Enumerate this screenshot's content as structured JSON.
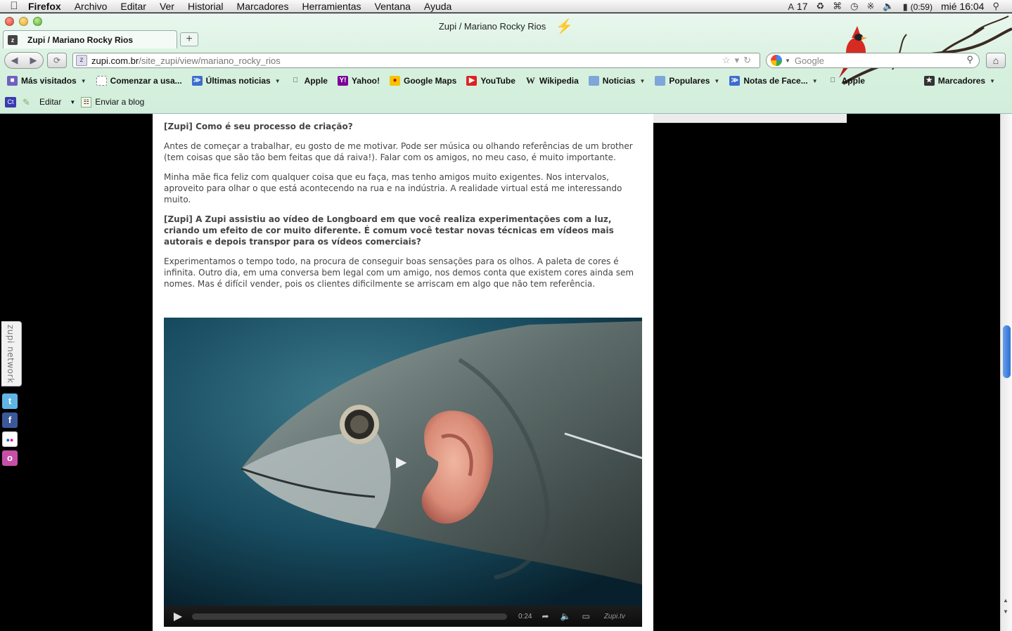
{
  "menubar": {
    "app_name": "Firefox",
    "items": [
      "Archivo",
      "Editar",
      "Ver",
      "Historial",
      "Marcadores",
      "Herramientas",
      "Ventana",
      "Ayuda"
    ],
    "status": {
      "adobe_count": "17",
      "battery": "(0:59)",
      "clock": "mié 16:04"
    }
  },
  "window": {
    "title": "Zupi / Mariano Rocky Rios"
  },
  "tab": {
    "label": "Zupi / Mariano Rocky Rios",
    "new_tab": "+"
  },
  "navigation": {
    "url_host": "zupi.com.br",
    "url_path": "/site_zupi/view/mariano_rocky_rios",
    "search_placeholder": "Google"
  },
  "bookmarks": {
    "items": [
      {
        "label": "Más visitados",
        "icon": "most-visited-icon",
        "dropdown": true
      },
      {
        "label": "Comenzar a usa...",
        "icon": "page-icon",
        "dropdown": false
      },
      {
        "label": "Últimas noticias",
        "icon": "rss-icon",
        "dropdown": true
      },
      {
        "label": "Apple",
        "icon": "apple-icon",
        "dropdown": false
      },
      {
        "label": "Yahoo!",
        "icon": "yahoo-icon",
        "dropdown": false
      },
      {
        "label": "Google Maps",
        "icon": "google-maps-icon",
        "dropdown": false
      },
      {
        "label": "YouTube",
        "icon": "youtube-icon",
        "dropdown": false
      },
      {
        "label": "Wikipedia",
        "icon": "wikipedia-icon",
        "dropdown": false
      },
      {
        "label": "Noticias",
        "icon": "folder-icon",
        "dropdown": true
      },
      {
        "label": "Populares",
        "icon": "folder-icon",
        "dropdown": true
      },
      {
        "label": "Notas de Face...",
        "icon": "rss-icon",
        "dropdown": true
      },
      {
        "label": "Apple",
        "icon": "apple-icon",
        "dropdown": false
      }
    ],
    "marcadores_label": "Marcadores"
  },
  "extension_bar": {
    "ct_label": "Ct",
    "edit_label": "Editar",
    "blog_label": "Enviar a blog"
  },
  "article": {
    "q1": "[Zupi] Como é seu processo de criação?",
    "a1": "Antes de começar a trabalhar, eu gosto de me motivar. Pode ser música ou olhando referências de um brother (tem coisas que são tão bem feitas que dá raiva!). Falar com os amigos, no meu caso, é muito importante.",
    "a2": "Minha mãe fica feliz com qualquer coisa que eu faça, mas tenho amigos muito exigentes. Nos intervalos, aproveito para olhar o que está acontecendo na rua e na indústria. A realidade virtual está me interessando muito.",
    "q2": "[Zupi] A Zupi assistiu ao vídeo de Longboard em que você realiza experimentações com a luz, criando um efeito de cor muito diferente. É comum você testar novas técnicas em vídeos mais autorais e depois transpor para os vídeos comerciais?",
    "a3": "Experimentamos o tempo todo, na procura de conseguir boas sensações para os olhos.  A paleta de cores é infinita. Outro dia, em uma conversa bem legal com um amigo, nos demos conta que existem cores ainda sem nomes. Mas é difícil vender, pois os clientes dificilmente se arriscam em algo que não tem referência."
  },
  "video": {
    "time": "0:24",
    "brand": "Zupi.tv",
    "progress": 0
  },
  "side_tab": {
    "label": "zupi network"
  },
  "social": [
    {
      "name": "twitter-icon",
      "glyph": "t",
      "color": "#5fb6e6"
    },
    {
      "name": "facebook-icon",
      "glyph": "f",
      "color": "#3b5998"
    },
    {
      "name": "flickr-icon",
      "glyph": "••",
      "color": "#ffffff"
    },
    {
      "name": "orkut-icon",
      "glyph": "o",
      "color": "#c84fa7"
    }
  ],
  "colors": {
    "chrome_bg": "#d6f0de",
    "page_bg": "#000000",
    "content_bg": "#ffffff",
    "scroll_thumb": "#2c6fd6"
  }
}
